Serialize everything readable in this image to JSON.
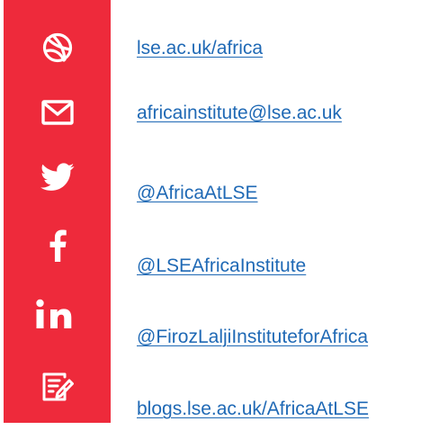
{
  "colors": {
    "brand_red": "#ee2a3b",
    "link_blue": "#1f69b5",
    "icon_white": "#ffffff"
  },
  "contacts": [
    {
      "icon": "globe-icon",
      "label": "lse.ac.uk/africa"
    },
    {
      "icon": "envelope-icon",
      "label": "africainstitute@lse.ac.uk"
    },
    {
      "icon": "twitter-icon",
      "label": "@AfricaAtLSE"
    },
    {
      "icon": "facebook-icon",
      "label": "@LSEAfricaInstitute"
    },
    {
      "icon": "linkedin-icon",
      "label": "@FirozLaljiInstituteforAfrica"
    },
    {
      "icon": "blog-icon",
      "label": "blogs.lse.ac.uk/AfricaAtLSE"
    }
  ]
}
